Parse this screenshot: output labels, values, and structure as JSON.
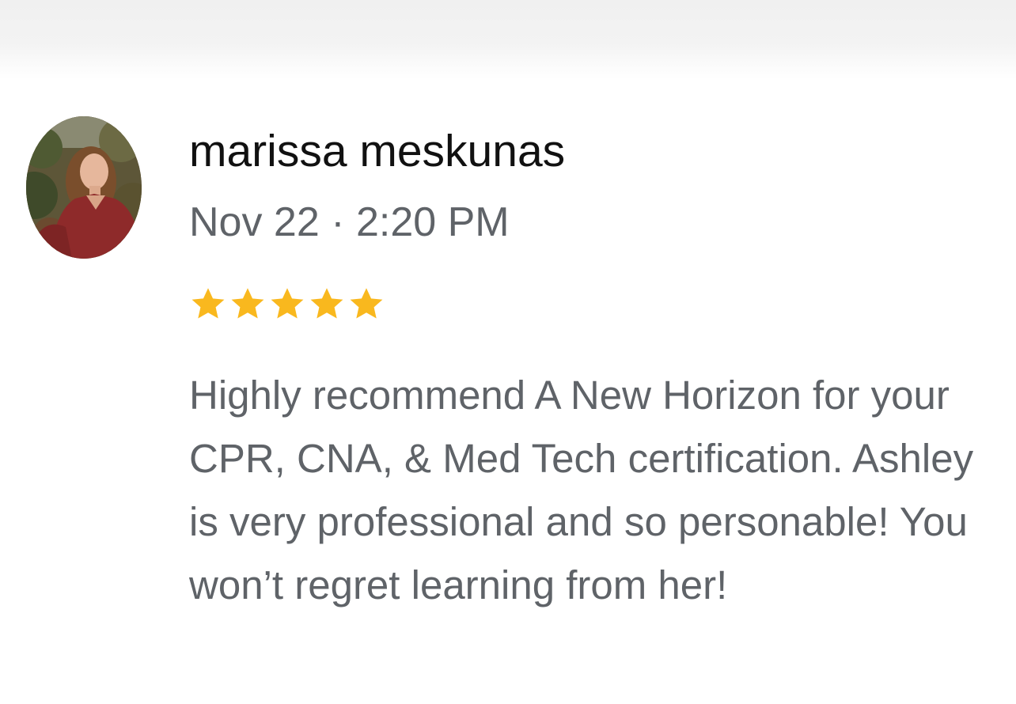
{
  "review": {
    "author": "marissa meskunas",
    "date": "Nov 22 · 2:20 PM",
    "rating": 5,
    "rating_max": 5,
    "text": "Highly recommend A New Horizon for your CPR, CNA, & Med Tech certification. Ashley is very professional and so personable! You won’t regret learning from her!",
    "avatar_icon": "user-photo",
    "star_icon": "star-icon"
  },
  "colors": {
    "star": "#f9b81e",
    "author": "#111111",
    "meta": "#5f6368",
    "top_band": "#f3f3f3"
  }
}
